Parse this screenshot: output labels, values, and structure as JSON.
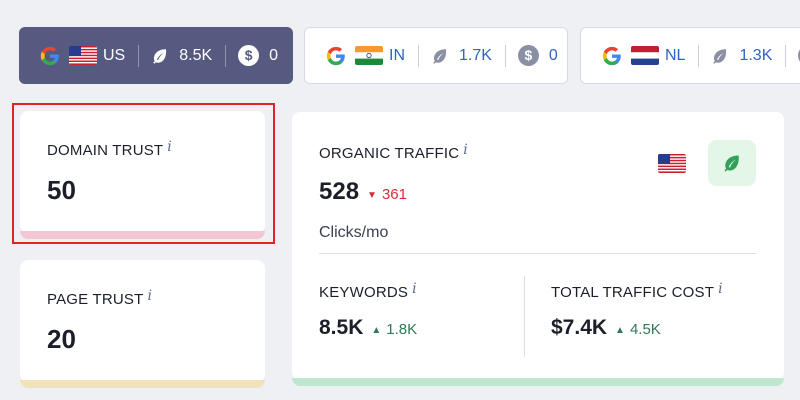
{
  "tabs": [
    {
      "code": "US",
      "traffic": "8.5K",
      "cost": "0",
      "active": true
    },
    {
      "code": "IN",
      "traffic": "1.7K",
      "cost": "0",
      "active": false
    },
    {
      "code": "NL",
      "traffic": "1.3K",
      "cost": "",
      "active": false
    }
  ],
  "domain_trust": {
    "label": "DOMAIN TRUST",
    "info": "i",
    "value": "50"
  },
  "page_trust": {
    "label": "PAGE TRUST",
    "info": "i",
    "value": "20"
  },
  "organic_traffic": {
    "label": "ORGANIC TRAFFIC",
    "info": "i",
    "value": "528",
    "delta": "361",
    "unit": "Clicks/mo"
  },
  "keywords": {
    "label": "KEYWORDS",
    "info": "i",
    "value": "8.5K",
    "delta": "1.8K"
  },
  "traffic_cost": {
    "label": "TOTAL TRAFFIC COST",
    "info": "i",
    "value": "$7.4K",
    "delta": "4.5K"
  },
  "colors": {
    "active_tab": "#575a80",
    "domain_bar": "#f2c6d2",
    "page_bar": "#f1e2b9",
    "organic_bar": "#bfe7d0",
    "down": "#d62c3a",
    "up": "#2f7a55",
    "highlight": "#e02424"
  }
}
